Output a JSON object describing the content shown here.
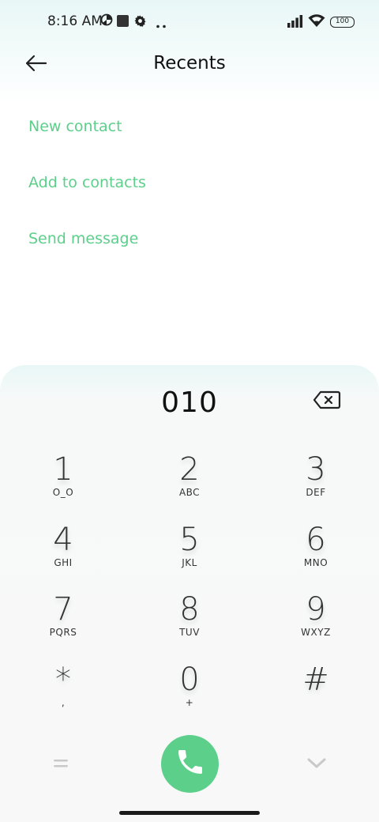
{
  "status_bar": {
    "time": "8:16 AM",
    "battery": "100",
    "icons": [
      "data-saver-icon",
      "square-app-icon",
      "gear-icon",
      "more-dots-icon",
      "signal-icon",
      "wifi-icon",
      "battery-icon"
    ]
  },
  "header": {
    "title": "Recents",
    "back_icon": "back-arrow-icon"
  },
  "actions": {
    "new_contact": "New contact",
    "add_to_contacts": "Add to contacts",
    "send_message": "Send message"
  },
  "dialer": {
    "number": "010",
    "backspace_icon": "backspace-icon",
    "keys": [
      {
        "digit": "1",
        "letters": "O_O"
      },
      {
        "digit": "2",
        "letters": "ABC"
      },
      {
        "digit": "3",
        "letters": "DEF"
      },
      {
        "digit": "4",
        "letters": "GHI"
      },
      {
        "digit": "5",
        "letters": "JKL"
      },
      {
        "digit": "6",
        "letters": "MNO"
      },
      {
        "digit": "7",
        "letters": "PQRS"
      },
      {
        "digit": "8",
        "letters": "TUV"
      },
      {
        "digit": "9",
        "letters": "WXYZ"
      },
      {
        "digit": "*",
        "letters": ","
      },
      {
        "digit": "0",
        "letters": "+"
      },
      {
        "digit": "#",
        "letters": ""
      }
    ],
    "bottom_icons": [
      "menu-equals-icon",
      "phone-call-icon",
      "chevron-down-icon"
    ],
    "accent_color": "#5ccf8b"
  }
}
